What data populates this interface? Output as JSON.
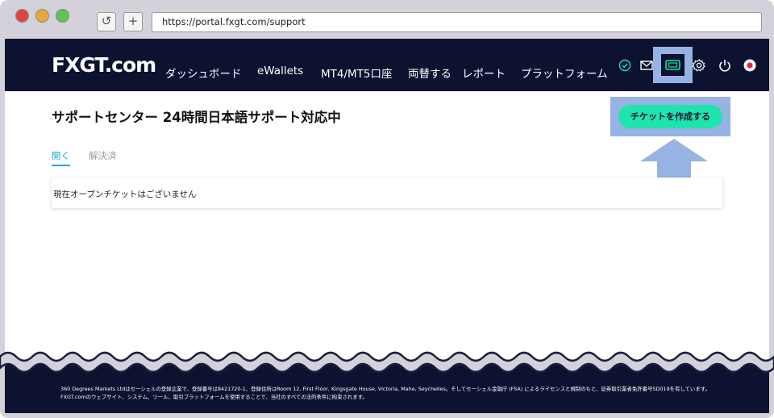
{
  "browser": {
    "url": "https://portal.fxgt.com/support",
    "reload_glyph": "↺",
    "newtab_glyph": "+"
  },
  "header": {
    "logo": "FXGT.com",
    "menu": [
      {
        "label": "ダッシュボード"
      },
      {
        "label": "eWallets"
      },
      {
        "label": "MT4/MT5口座"
      },
      {
        "label": "両替する"
      },
      {
        "label": "レポート"
      },
      {
        "label": "プラットフォーム"
      }
    ],
    "icons": [
      "verified-check-icon",
      "mail-icon",
      "ticket-icon",
      "gear-icon",
      "power-icon",
      "language-flag-icon"
    ]
  },
  "page": {
    "title": "サポートセンター 24時間日本語サポート対応中",
    "create_button": "チケットを作成する",
    "tabs": [
      {
        "label": "開く",
        "active": true
      },
      {
        "label": "解決済",
        "active": false
      }
    ],
    "empty_message": "現在オープンチケットはございません"
  },
  "footer": {
    "text": "360 Degrees Markets Ltdはセーシェルの登録企業で、登録番号は8421720-1、登録住所はRoom 12, First Floor, Kingsgate House, Victoria, Mahe, Seychelles。そしてセーシェル金融庁 (FSA) によるライセンスと規制のもと、証券取引業者免許番号SD019を有しています。FXGT.comのウェブサイト、システム、ツール、取引プラットフォームを使用することで、当社のすべての法的条件に拘束されます。"
  },
  "colors": {
    "nav_bg": "#0c1230",
    "accent_green": "#1fe4ae",
    "highlight_blue": "#97b3e3",
    "tab_active": "#2aa6d6"
  }
}
